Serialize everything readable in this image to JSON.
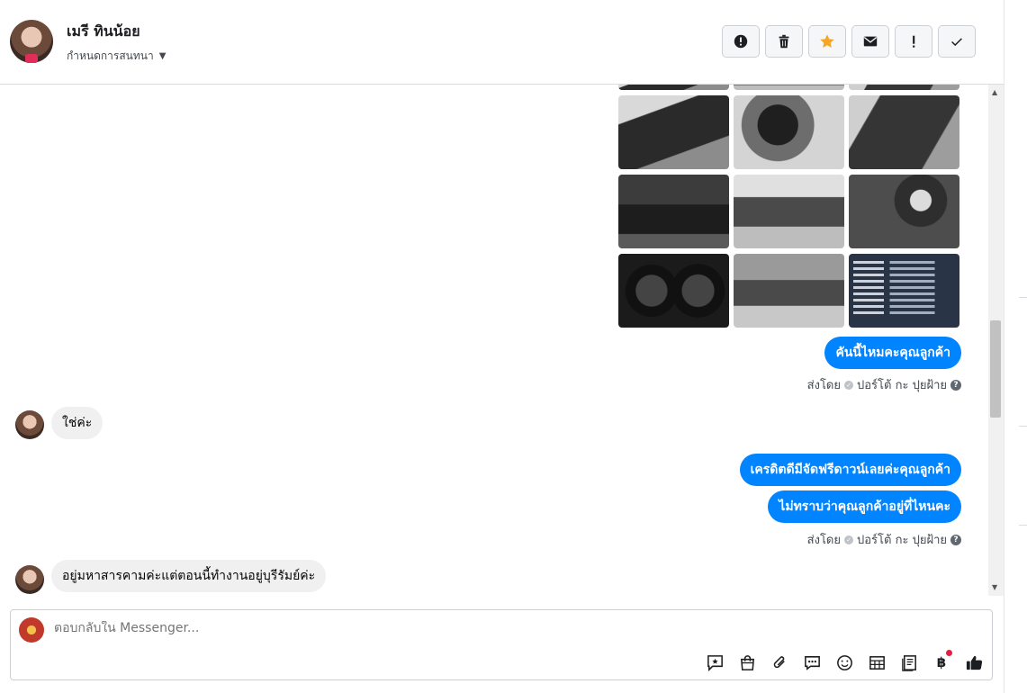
{
  "header": {
    "contact_name": "เมรี ทินน้อย",
    "assign_label": "กำหนดการสนทนา",
    "actions": [
      "spam",
      "delete",
      "star",
      "mark-unread",
      "follow-up",
      "done"
    ]
  },
  "conversation": {
    "outgoing_1": "คันนี้ไหมคะคุณลูกค้า",
    "sent_by_1": "ส่งโดย",
    "sender_1": "ปอร์โต้ กะ ปุยฝ้าย",
    "incoming_1": "ใช่ค่ะ",
    "outgoing_2": "เครดิตดีมีจัดฟรีดาวน์เลยค่ะคุณลูกค้า",
    "outgoing_3": "ไม่ทราบว่าคุณลูกค้าอยู่ที่ไหนคะ",
    "sent_by_2": "ส่งโดย",
    "sender_2": "ปอร์โต้ กะ ปุยฝ้าย",
    "incoming_2": "อยู่มหาสารคามค่ะแต่ตอนนี้ทำงานอยู่บุรีรัมย์ค่ะ"
  },
  "composer": {
    "placeholder": "ตอบกลับใน Messenger...",
    "tools": [
      "saved-reply-icon",
      "shopping-bag-icon",
      "attachment-icon",
      "chat-bubbles-icon",
      "emoji-icon",
      "table-icon",
      "notes-icon",
      "baht-icon",
      "thumbs-up-icon"
    ],
    "baht_symbol": "฿"
  },
  "colors": {
    "accent": "#0084ff",
    "star": "#f5a623",
    "notify": "#e41e3f"
  }
}
